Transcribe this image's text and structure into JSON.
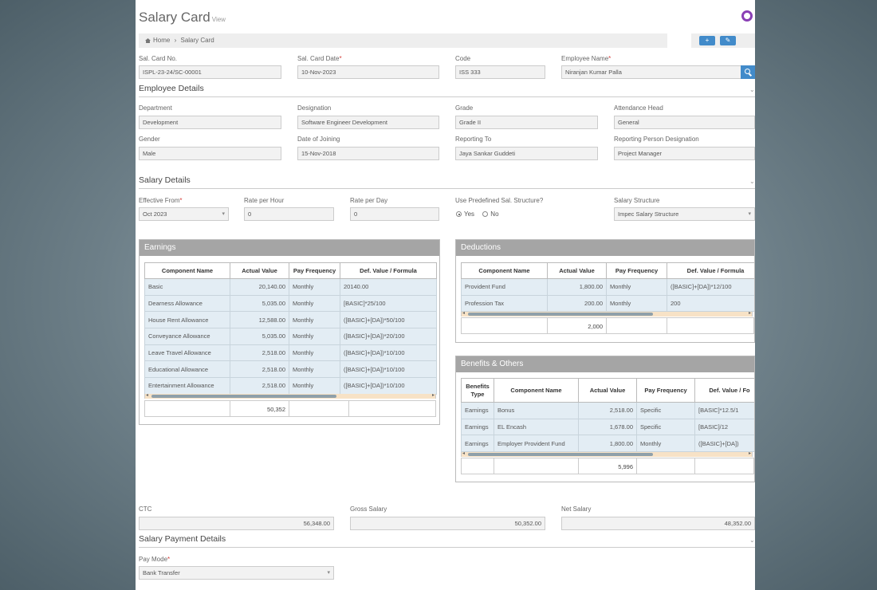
{
  "header": {
    "title": "Salary Card",
    "subtitle": "View"
  },
  "breadcrumb": {
    "home": "Home",
    "sep": "›",
    "current": "Salary Card"
  },
  "toolbar": {
    "add_glyph": "+",
    "edit_glyph": "✎"
  },
  "icons": {
    "home": "home-icon",
    "search": "search-icon",
    "add": "add-icon",
    "edit": "edit-icon",
    "status": "ring-icon"
  },
  "colors": {
    "accent": "#428bca",
    "ring": "#8a3fb5",
    "panel_header": "#a5a5a5",
    "row_bg": "#e3edf4"
  },
  "top_fields": {
    "card_no": {
      "label": "Sal. Card No.",
      "value": "ISPL-23-24/SC-00001"
    },
    "card_date": {
      "label": "Sal. Card Date",
      "value": "10-Nov-2023"
    },
    "code": {
      "label": "Code",
      "value": "ISS 333"
    },
    "employee_name": {
      "label": "Employee Name",
      "value": "Niranjan Kumar Palla"
    }
  },
  "employee_details": {
    "title": "Employee Details",
    "department": {
      "label": "Department",
      "value": "Development"
    },
    "designation": {
      "label": "Designation",
      "value": "Software Engineer Development"
    },
    "grade": {
      "label": "Grade",
      "value": "Grade II"
    },
    "attendance_head": {
      "label": "Attendance Head",
      "value": "General"
    },
    "gender": {
      "label": "Gender",
      "value": "Male"
    },
    "doj": {
      "label": "Date of Joining",
      "value": "15-Nov-2018"
    },
    "reporting_to": {
      "label": "Reporting To",
      "value": "Jaya Sankar Guddeti"
    },
    "reporting_designation": {
      "label": "Reporting Person Designation",
      "value": "Project Manager"
    }
  },
  "salary_details": {
    "title": "Salary Details",
    "effective_from": {
      "label": "Effective From",
      "value": "Oct 2023"
    },
    "rate_hour": {
      "label": "Rate per Hour",
      "value": "0"
    },
    "rate_day": {
      "label": "Rate per Day",
      "value": "0"
    },
    "predefined": {
      "label": "Use Predefined Sal. Structure?",
      "yes": "Yes",
      "no": "No"
    },
    "structure": {
      "label": "Salary Structure",
      "value": "Impec Salary Structure"
    }
  },
  "earnings": {
    "title": "Earnings",
    "headers": [
      "Component Name",
      "Actual Value",
      "Pay Frequency",
      "Def. Value / Formula"
    ],
    "rows": [
      [
        "Basic",
        "20,140.00",
        "Monthly",
        "20140.00"
      ],
      [
        "Dearness Allowance",
        "5,035.00",
        "Monthly",
        "[BASIC]*25/100"
      ],
      [
        "House Rent Allowance",
        "12,588.00",
        "Monthly",
        "([BASIC]+[DA])*50/100"
      ],
      [
        "Conveyance Allowance",
        "5,035.00",
        "Monthly",
        "([BASIC]+[DA])*20/100"
      ],
      [
        "Leave Travel Allowance",
        "2,518.00",
        "Monthly",
        "([BASIC]+[DA])*10/100"
      ],
      [
        "Educational Allowance",
        "2,518.00",
        "Monthly",
        "([BASIC]+[DA])*10/100"
      ],
      [
        "Entertainment Allowance",
        "2,518.00",
        "Monthly",
        "([BASIC]+[DA])*10/100"
      ]
    ],
    "total": "50,352"
  },
  "deductions": {
    "title": "Deductions",
    "headers": [
      "Component Name",
      "Actual Value",
      "Pay Frequency",
      "Def. Value / Formula"
    ],
    "rows": [
      [
        "Provident Fund",
        "1,800.00",
        "Monthly",
        "([BASIC]+[DA])*12/100"
      ],
      [
        "Profession Tax",
        "200.00",
        "Monthly",
        "200"
      ]
    ],
    "total": "2,000"
  },
  "benefits": {
    "title": "Benefits & Others",
    "headers": [
      "Benefits Type",
      "Component Name",
      "Actual Value",
      "Pay Frequency",
      "Def. Value / Fo"
    ],
    "rows": [
      [
        "Earnings",
        "Bonus",
        "2,518.00",
        "Specific",
        "[BASIC]*12.5/1"
      ],
      [
        "Earnings",
        "EL Encash",
        "1,678.00",
        "Specific",
        "[BASIC]/12"
      ],
      [
        "Earnings",
        "Employer Provident Fund",
        "1,800.00",
        "Monthly",
        "([BASIC]+[DA])"
      ]
    ],
    "total": "5,996"
  },
  "totals": {
    "ctc": {
      "label": "CTC",
      "value": "56,348.00"
    },
    "gross": {
      "label": "Gross Salary",
      "value": "50,352.00"
    },
    "net": {
      "label": "Net Salary",
      "value": "48,352.00"
    }
  },
  "payment": {
    "title": "Salary Payment Details",
    "pay_mode": {
      "label": "Pay Mode",
      "value": "Bank Transfer"
    }
  }
}
